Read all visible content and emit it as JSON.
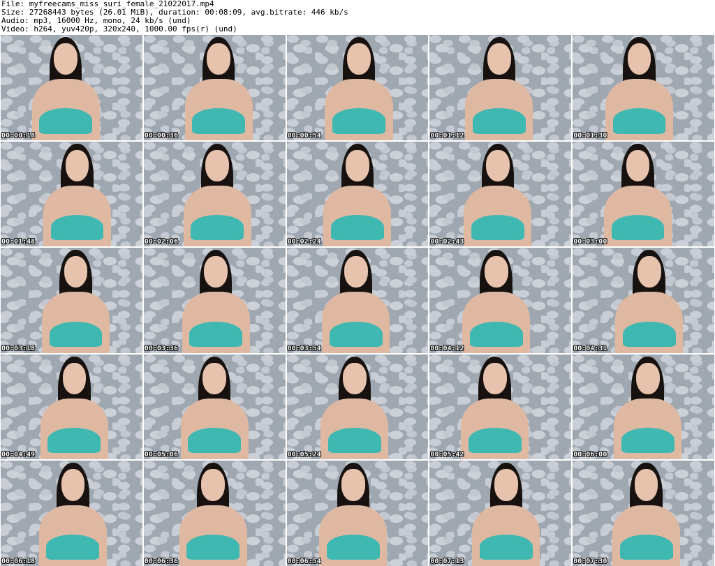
{
  "header": {
    "lines": [
      "File: myfreecams_miss_suri_female_21022017.mp4",
      "Size: 27268443 bytes (26.01 MiB), duration: 00:08:09, avg.bitrate: 446 kb/s",
      "Audio: mp3, 16000 Hz, mono, 24 kb/s (und)",
      "Video: h264, yuv420p, 320x240, 1000.00 fps(r) (und)"
    ]
  },
  "thumbnails": [
    {
      "time": "00:00:18"
    },
    {
      "time": "00:00:36"
    },
    {
      "time": "00:00:54"
    },
    {
      "time": "00:01:12"
    },
    {
      "time": "00:01:30"
    },
    {
      "time": "00:01:48"
    },
    {
      "time": "00:02:06"
    },
    {
      "time": "00:02:24"
    },
    {
      "time": "00:02:43"
    },
    {
      "time": "00:03:00"
    },
    {
      "time": "00:03:18"
    },
    {
      "time": "00:03:36"
    },
    {
      "time": "00:03:54"
    },
    {
      "time": "00:04:12"
    },
    {
      "time": "00:04:31"
    },
    {
      "time": "00:04:49"
    },
    {
      "time": "00:05:06"
    },
    {
      "time": "00:05:24"
    },
    {
      "time": "00:05:42"
    },
    {
      "time": "00:06:00"
    },
    {
      "time": "00:06:18"
    },
    {
      "time": "00:06:36"
    },
    {
      "time": "00:06:54"
    },
    {
      "time": "00:07:13"
    },
    {
      "time": "00:07:30"
    }
  ]
}
